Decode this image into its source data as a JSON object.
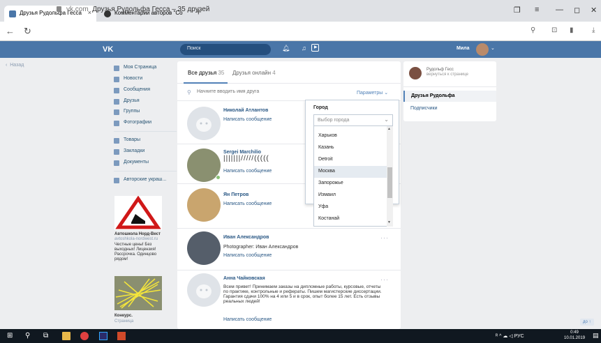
{
  "browser": {
    "tabs": [
      {
        "label": "Друзья Рудольфа Гесса",
        "close": "×"
      },
      {
        "label": "Комментарии авторов \"Со",
        "close": ""
      }
    ],
    "new_tab": "+",
    "url_domain": "vk.com",
    "url_title": "Друзья Рудольфа Гесса – 35 друзей"
  },
  "header": {
    "logo": "VK",
    "search_placeholder": "Поиск",
    "user_name": "Мила"
  },
  "nav": {
    "back": "Назад",
    "items": [
      "Моя Страница",
      "Новости",
      "Сообщения",
      "Друзья",
      "Группы",
      "Фотографии",
      "Товары",
      "Закладки",
      "Документы",
      "Авторские украш..."
    ]
  },
  "ads": [
    {
      "title": "Автошкола Норд-Вест",
      "url": "avtoshkola-nordwest.ru",
      "text": "Честные цены! Без выходных! Лицензия! Рассрочка. Одинцово рядом!"
    },
    {
      "title": "Конкурс.",
      "url": "Страница"
    }
  ],
  "friends_tabs": {
    "all_label": "Все друзья",
    "all_count": "35",
    "online_label": "Друзья онлайн",
    "online_count": "4"
  },
  "search": {
    "placeholder": "Начните вводить имя друга",
    "params": "Параметры"
  },
  "friends": [
    {
      "name": "Николай Атлантов",
      "desc": "",
      "msg": "Написать сообщение"
    },
    {
      "name": "Sergei Marchilio",
      "desc": "",
      "msg": "Написать сообщение"
    },
    {
      "name": "Ян Петров",
      "desc": "",
      "msg": "Написать сообщение"
    },
    {
      "name": "Иван Александров",
      "desc": "Photographer: Иван Александров",
      "msg": "Написать сообщение"
    },
    {
      "name": "Анна Чайковская",
      "desc": "Всем привет! Принимаем заказы на дипломные работы, курсовые, отчеты по практике, контрольные и рефераты. Пишем магистерские диссертации. Гарантия сдачи 100% на 4 или 5 и в срок, опыт более 15 лет. Есть отзывы реальных людей!",
      "msg": "Написать сообщение"
    }
  ],
  "filter": {
    "city_label": "Город",
    "city_placeholder": "Выбор города",
    "cities": [
      "Харьков",
      "Казань",
      "Detroit",
      "Москва",
      "Запорожье",
      "Измаил",
      "Уфа",
      "Костанай"
    ],
    "selected_city": "Москва"
  },
  "profile_panel": {
    "name": "Рудольф Гесс",
    "back": "вернуться к странице",
    "friends_tab": "Друзья Рудольфа",
    "subs_tab": "Подписчики"
  },
  "page_up": "до ↑",
  "taskbar": {
    "tray": "ᴿ ^ ☁ ◁ РУС",
    "time": "0:49",
    "date": "10.01.2019"
  },
  "colors": {
    "vk_blue": "#4a76a8",
    "link": "#2a5885",
    "accent": "#5181b8"
  }
}
